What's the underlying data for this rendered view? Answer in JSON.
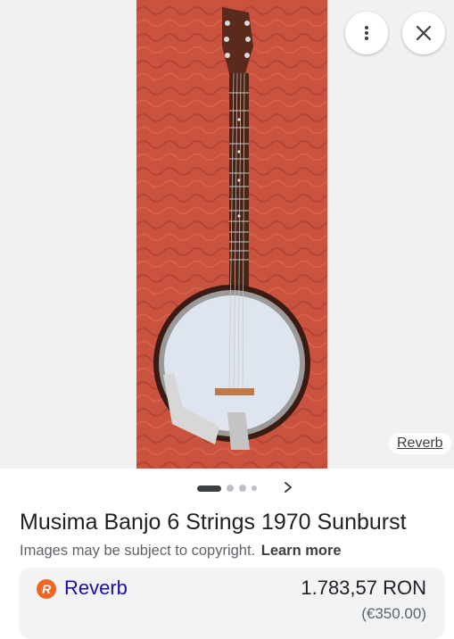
{
  "viewer": {
    "image_subject": "banjo",
    "more_icon": "vertical-dots-icon",
    "close_icon": "close-icon",
    "source_tag": "Reverb"
  },
  "pager": {
    "total_dots": 4,
    "active_index": 0,
    "next_icon": "chevron-right-icon"
  },
  "result": {
    "title": "Musima Banjo 6 Strings 1970 Sunburst",
    "copyright_notice": "Images may be subject to copyright.",
    "learn_more": "Learn more"
  },
  "card": {
    "logo_icon": "reverb-logo-icon",
    "logo_letter": "R",
    "source": "Reverb",
    "price": "1.783,57 RON",
    "alt_price": "(€350.00)"
  },
  "colors": {
    "backdrop": "#c9533f",
    "reverb_orange": "#f26522",
    "link_blue": "#1a0dab"
  }
}
